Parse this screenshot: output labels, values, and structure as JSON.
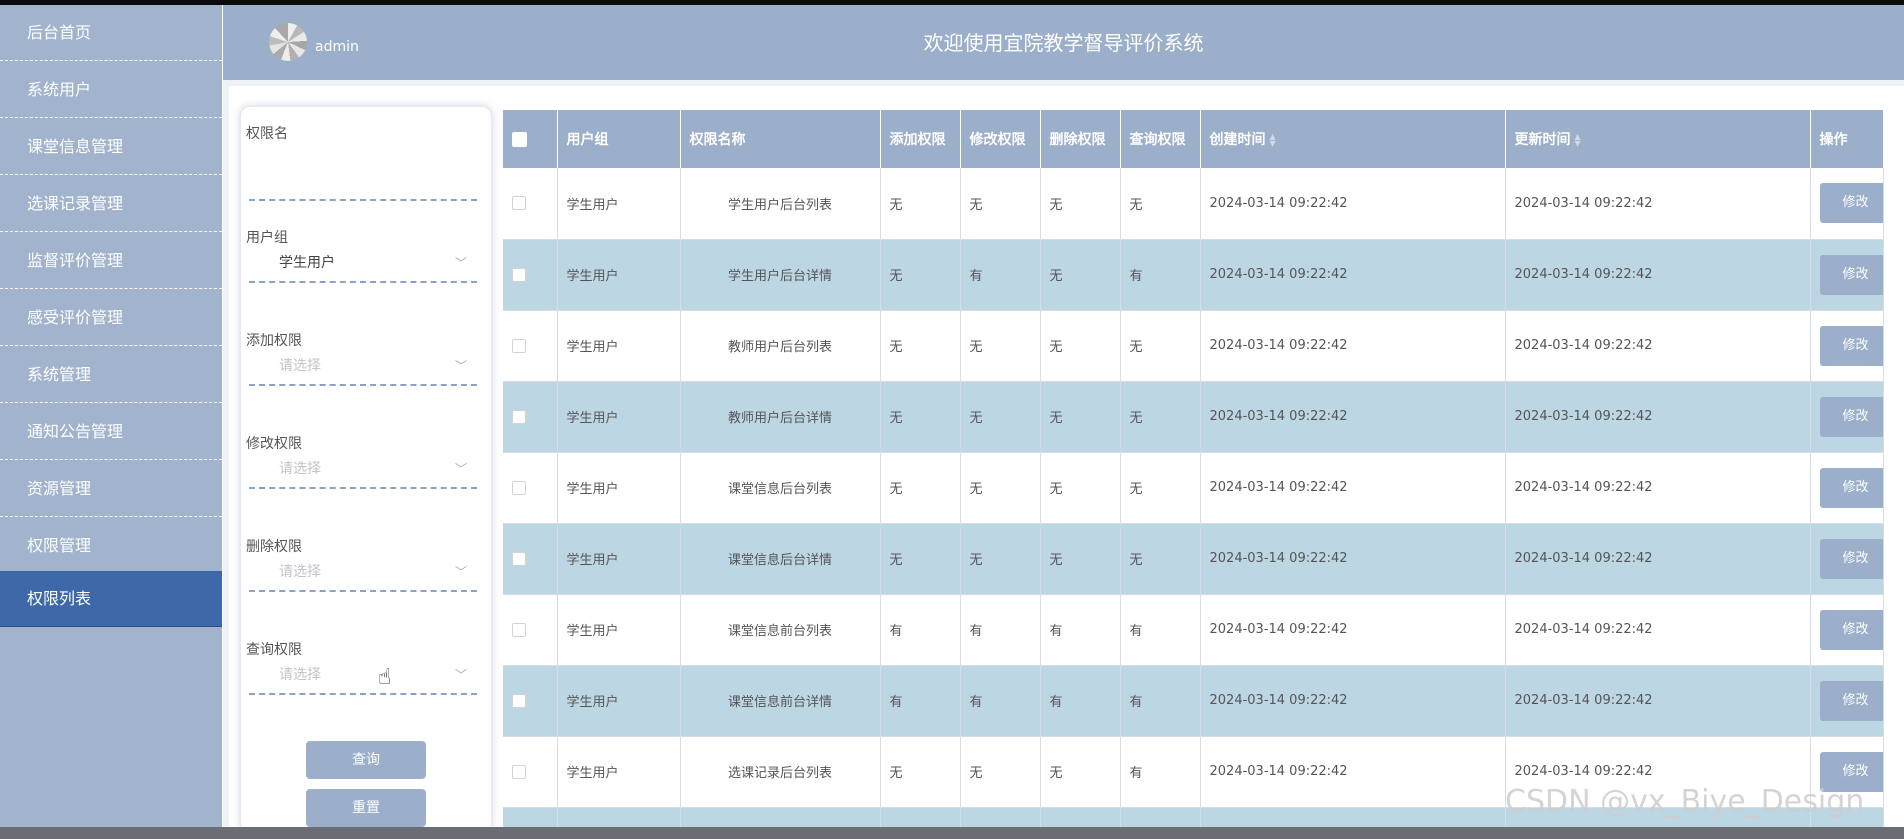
{
  "sidebar": {
    "items": [
      {
        "label": "后台首页"
      },
      {
        "label": "系统用户"
      },
      {
        "label": "课堂信息管理"
      },
      {
        "label": "选课记录管理"
      },
      {
        "label": "监督评价管理"
      },
      {
        "label": "感受评价管理"
      },
      {
        "label": "系统管理"
      },
      {
        "label": "通知公告管理"
      },
      {
        "label": "资源管理"
      },
      {
        "label": "权限管理"
      },
      {
        "label": "权限列表"
      }
    ],
    "active_index": 10
  },
  "header": {
    "username": "admin",
    "title": "欢迎使用宜院教学督导评价系统"
  },
  "filter": {
    "perm_name_label": "权限名",
    "perm_name_value": "",
    "group_label": "用户组",
    "group_value": "学生用户",
    "add_label": "添加权限",
    "add_placeholder": "请选择",
    "edit_label": "修改权限",
    "edit_placeholder": "请选择",
    "delete_label": "删除权限",
    "delete_placeholder": "请选择",
    "query_label": "查询权限",
    "query_placeholder": "请选择",
    "search_button": "查询",
    "reset_button": "重置"
  },
  "table": {
    "headers": {
      "group": "用户组",
      "perm_name": "权限名称",
      "add": "添加权限",
      "edit": "修改权限",
      "delete": "删除权限",
      "query": "查询权限",
      "created": "创建时间",
      "updated": "更新时间",
      "action": "操作"
    },
    "edit_label": "修改",
    "rows": [
      {
        "group": "学生用户",
        "perm_name": "学生用户后台列表",
        "add": "无",
        "edit": "无",
        "delete": "无",
        "query": "无",
        "created": "2024-03-14 09:22:42",
        "updated": "2024-03-14 09:22:42"
      },
      {
        "group": "学生用户",
        "perm_name": "学生用户后台详情",
        "add": "无",
        "edit": "有",
        "delete": "无",
        "query": "有",
        "created": "2024-03-14 09:22:42",
        "updated": "2024-03-14 09:22:42"
      },
      {
        "group": "学生用户",
        "perm_name": "教师用户后台列表",
        "add": "无",
        "edit": "无",
        "delete": "无",
        "query": "无",
        "created": "2024-03-14 09:22:42",
        "updated": "2024-03-14 09:22:42"
      },
      {
        "group": "学生用户",
        "perm_name": "教师用户后台详情",
        "add": "无",
        "edit": "无",
        "delete": "无",
        "query": "无",
        "created": "2024-03-14 09:22:42",
        "updated": "2024-03-14 09:22:42"
      },
      {
        "group": "学生用户",
        "perm_name": "课堂信息后台列表",
        "add": "无",
        "edit": "无",
        "delete": "无",
        "query": "无",
        "created": "2024-03-14 09:22:42",
        "updated": "2024-03-14 09:22:42"
      },
      {
        "group": "学生用户",
        "perm_name": "课堂信息后台详情",
        "add": "无",
        "edit": "无",
        "delete": "无",
        "query": "无",
        "created": "2024-03-14 09:22:42",
        "updated": "2024-03-14 09:22:42"
      },
      {
        "group": "学生用户",
        "perm_name": "课堂信息前台列表",
        "add": "有",
        "edit": "有",
        "delete": "有",
        "query": "有",
        "created": "2024-03-14 09:22:42",
        "updated": "2024-03-14 09:22:42"
      },
      {
        "group": "学生用户",
        "perm_name": "课堂信息前台详情",
        "add": "有",
        "edit": "有",
        "delete": "有",
        "query": "有",
        "created": "2024-03-14 09:22:42",
        "updated": "2024-03-14 09:22:42"
      },
      {
        "group": "学生用户",
        "perm_name": "选课记录后台列表",
        "add": "无",
        "edit": "无",
        "delete": "无",
        "query": "有",
        "created": "2024-03-14 09:22:42",
        "updated": "2024-03-14 09:22:42"
      }
    ]
  },
  "watermark": "CSDN @vx_Biye_Design"
}
